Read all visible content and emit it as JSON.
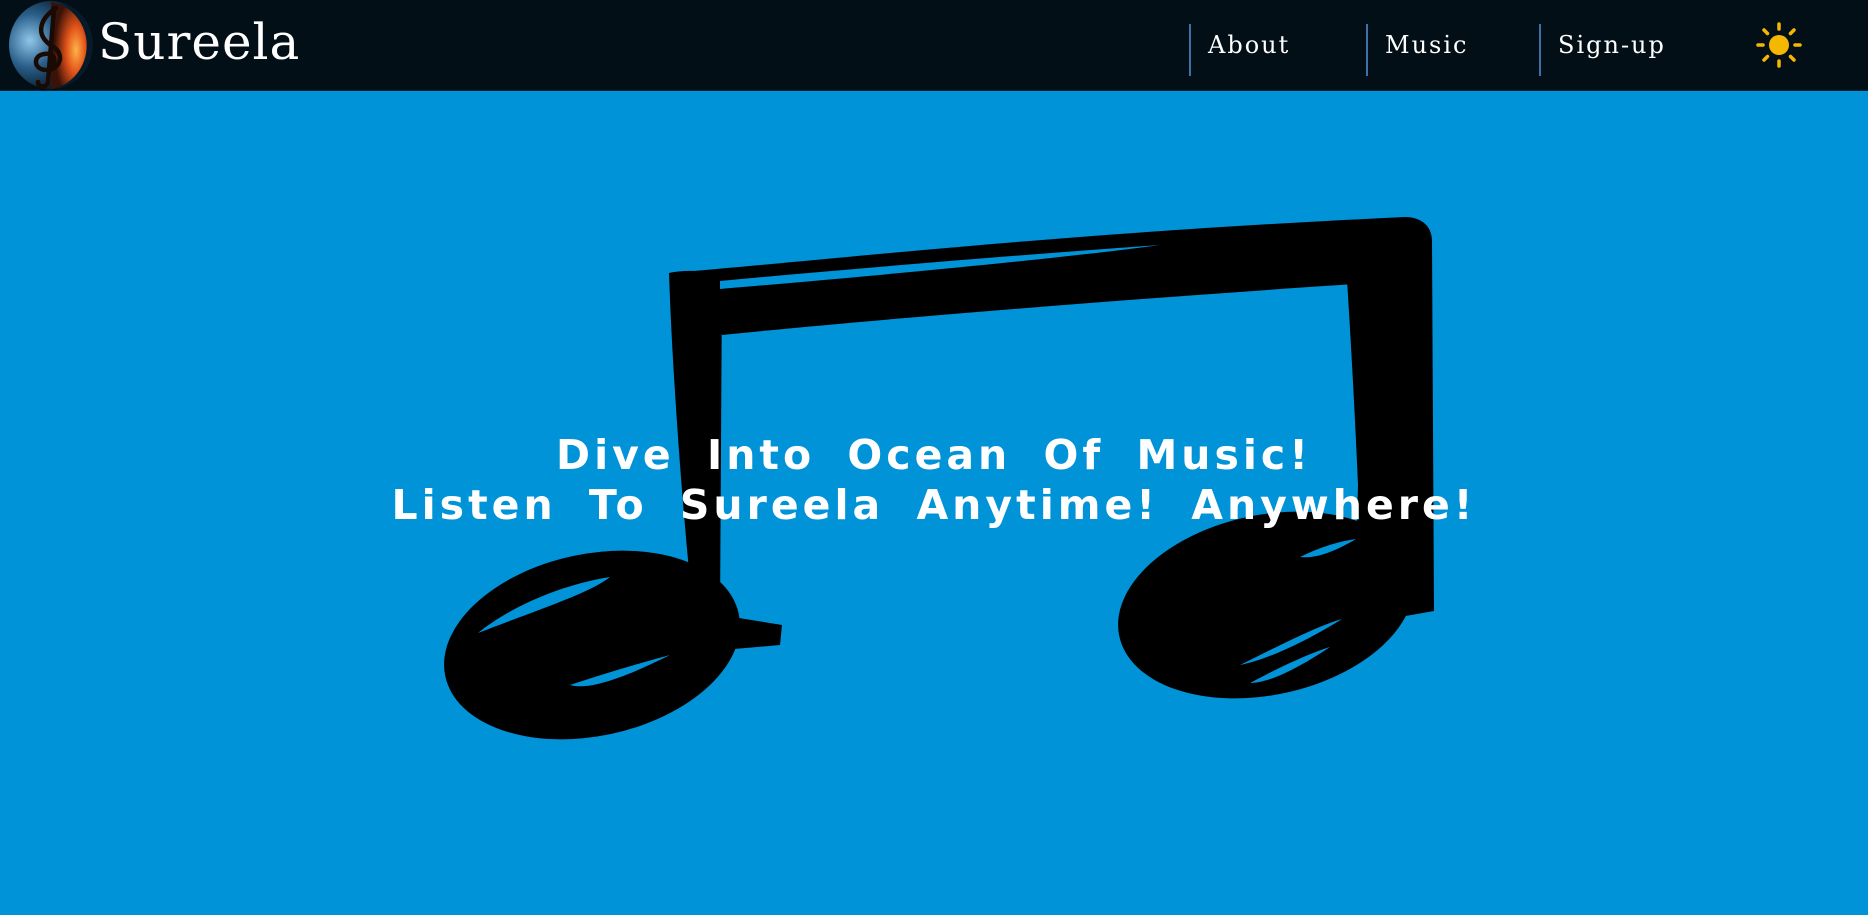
{
  "brand": {
    "name": "Sureela",
    "logo_icon": "treble-clef-fire-water-icon"
  },
  "nav": {
    "items": [
      {
        "label": "About"
      },
      {
        "label": "Music"
      },
      {
        "label": "Sign-up"
      }
    ],
    "theme_toggle_icon": "sun-icon"
  },
  "hero": {
    "line1": "Dive Into Ocean Of Music!",
    "line2": "Listen To Sureela Anytime! Anywhere!",
    "background_icon": "music-note-icon"
  },
  "colors": {
    "background": "#0093d8",
    "navbar": "#030f16",
    "nav_divider": "#3f72a4",
    "text": "#ffffff",
    "sun": "#f5b800",
    "note": "#000000"
  }
}
